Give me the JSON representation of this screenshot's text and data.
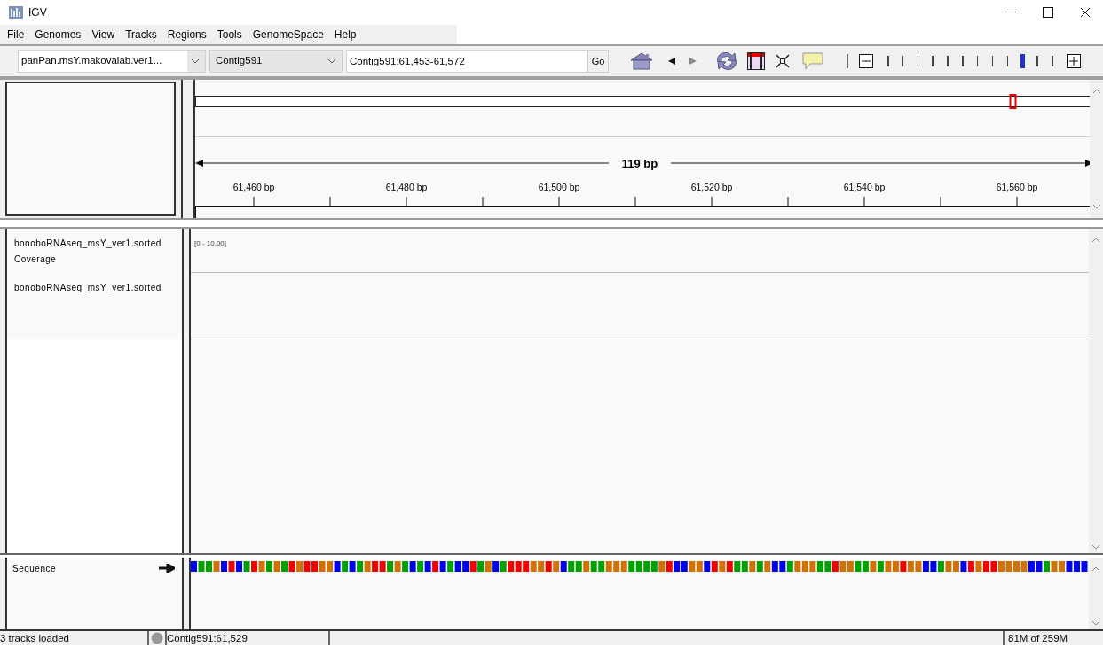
{
  "window": {
    "title": "IGV"
  },
  "menu": [
    "File",
    "Genomes",
    "View",
    "Tracks",
    "Regions",
    "Tools",
    "GenomeSpace",
    "Help"
  ],
  "toolbar": {
    "genome": "panPan.msY.makovalab.ver1...",
    "chromosome": "Contig591",
    "locus": "Contig591:61,453-61,572",
    "go": "Go",
    "zoom": {
      "level": 0.82
    }
  },
  "ruler": {
    "span": "119 bp",
    "ticks": [
      "61,460 bp",
      "61,480 bp",
      "61,500 bp",
      "61,520 bp",
      "61,540 bp",
      "61,560 bp"
    ]
  },
  "tracks": [
    {
      "kind": "coverage",
      "name": "bonoboRNAseq_msY_ver1.sorted Coverage",
      "range": "[0 - 10.00]"
    },
    {
      "kind": "alignment",
      "name": "bonoboRNAseq_msY_ver1.sorted"
    }
  ],
  "sequence": {
    "label": "Sequence"
  },
  "status_bar": {
    "message": "3 tracks loaded",
    "position": "Contig591:61,529",
    "memory": "81M of 259M"
  }
}
